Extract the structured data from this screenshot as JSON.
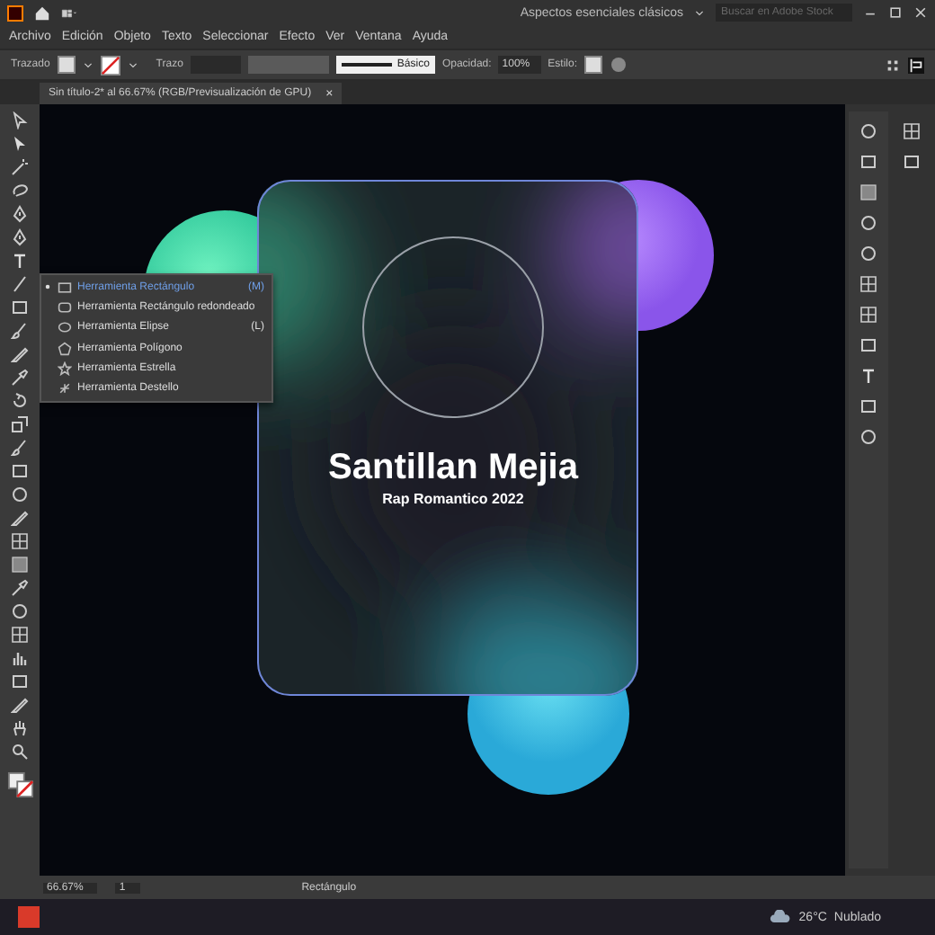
{
  "app": {
    "workspace": "Aspectos esenciales clásicos",
    "search": {
      "placeholder": "Buscar en Adobe Stock"
    }
  },
  "menu": [
    "Archivo",
    "Edición",
    "Objeto",
    "Texto",
    "Seleccionar",
    "Efecto",
    "Ver",
    "Ventana",
    "Ayuda"
  ],
  "control_bar": {
    "selection": "Trazado",
    "stroke_label": "Trazo",
    "brush": "Básico",
    "opacity_label": "Opacidad:",
    "opacity": "100%",
    "style_label": "Estilo:"
  },
  "document_tab": {
    "title": "Sin título-2* al 66.67% (RGB/Previsualización de GPU)",
    "close": "×"
  },
  "flyout": [
    {
      "label": "Herramienta Rectángulo",
      "shortcut": "(M)",
      "selected": true,
      "kind": "rect"
    },
    {
      "label": "Herramienta Rectángulo redondeado",
      "selected": false,
      "kind": "rounded"
    },
    {
      "label": "Herramienta Elipse",
      "shortcut": "(L)",
      "selected": false,
      "kind": "ellipse"
    },
    {
      "label": "Herramienta Polígono",
      "selected": false,
      "kind": "polygon"
    },
    {
      "label": "Herramienta Estrella",
      "selected": false,
      "kind": "star"
    },
    {
      "label": "Herramienta Destello",
      "selected": false,
      "kind": "flare"
    }
  ],
  "artwork": {
    "title": "Santillan Mejia",
    "subtitle": "Rap Romantico 2022"
  },
  "status_bar": {
    "zoom": "66.67%",
    "artboard": "1",
    "tool": "Rectángulo"
  },
  "taskbar": {
    "temperature": "26°C",
    "weather": "Nublado"
  }
}
